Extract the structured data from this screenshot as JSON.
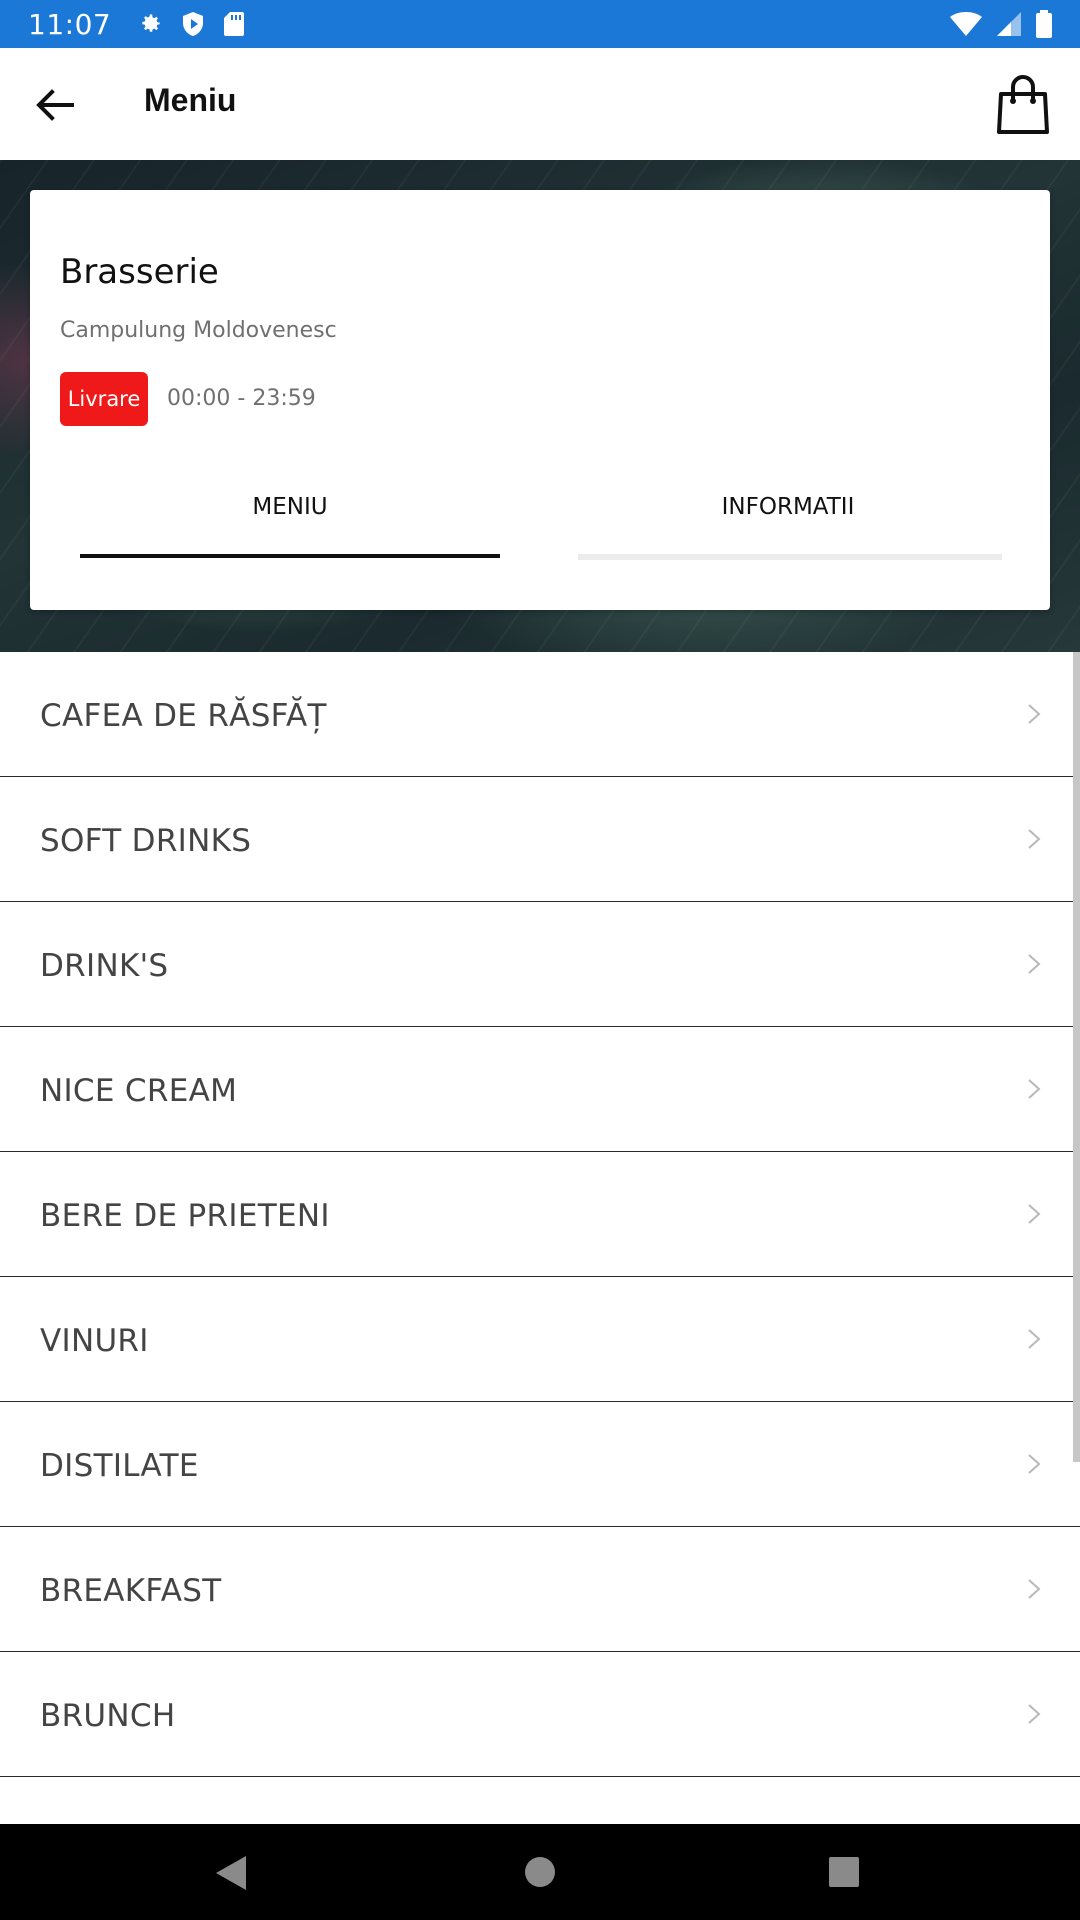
{
  "status_bar": {
    "time": "11:07",
    "left_icons": [
      "settings-icon",
      "shield-icon",
      "sd-card-icon"
    ],
    "right_icons": [
      "wifi-icon",
      "signal-icon",
      "battery-icon"
    ]
  },
  "app_bar": {
    "title": "Meniu",
    "back_icon": "arrow-back-icon",
    "cart_icon": "shopping-bag-icon"
  },
  "restaurant": {
    "name": "Brasserie",
    "location": "Campulung Moldovenesc",
    "badge": "Livrare",
    "badge_color": "#f01919",
    "hours": "00:00 - 23:59"
  },
  "tabs": [
    {
      "label": "MENIU",
      "active": true
    },
    {
      "label": "INFORMATII",
      "active": false
    }
  ],
  "categories": [
    {
      "label": "CAFEA DE RĂSFĂȚ"
    },
    {
      "label": "SOFT DRINKS"
    },
    {
      "label": "DRINK'S"
    },
    {
      "label": "NICE CREAM"
    },
    {
      "label": "BERE DE PRIETENI"
    },
    {
      "label": "VINURI"
    },
    {
      "label": "DISTILATE"
    },
    {
      "label": "BREAKFAST"
    },
    {
      "label": "BRUNCH"
    }
  ],
  "colors": {
    "status_bar": "#1c78d6",
    "accent": "#111111"
  }
}
